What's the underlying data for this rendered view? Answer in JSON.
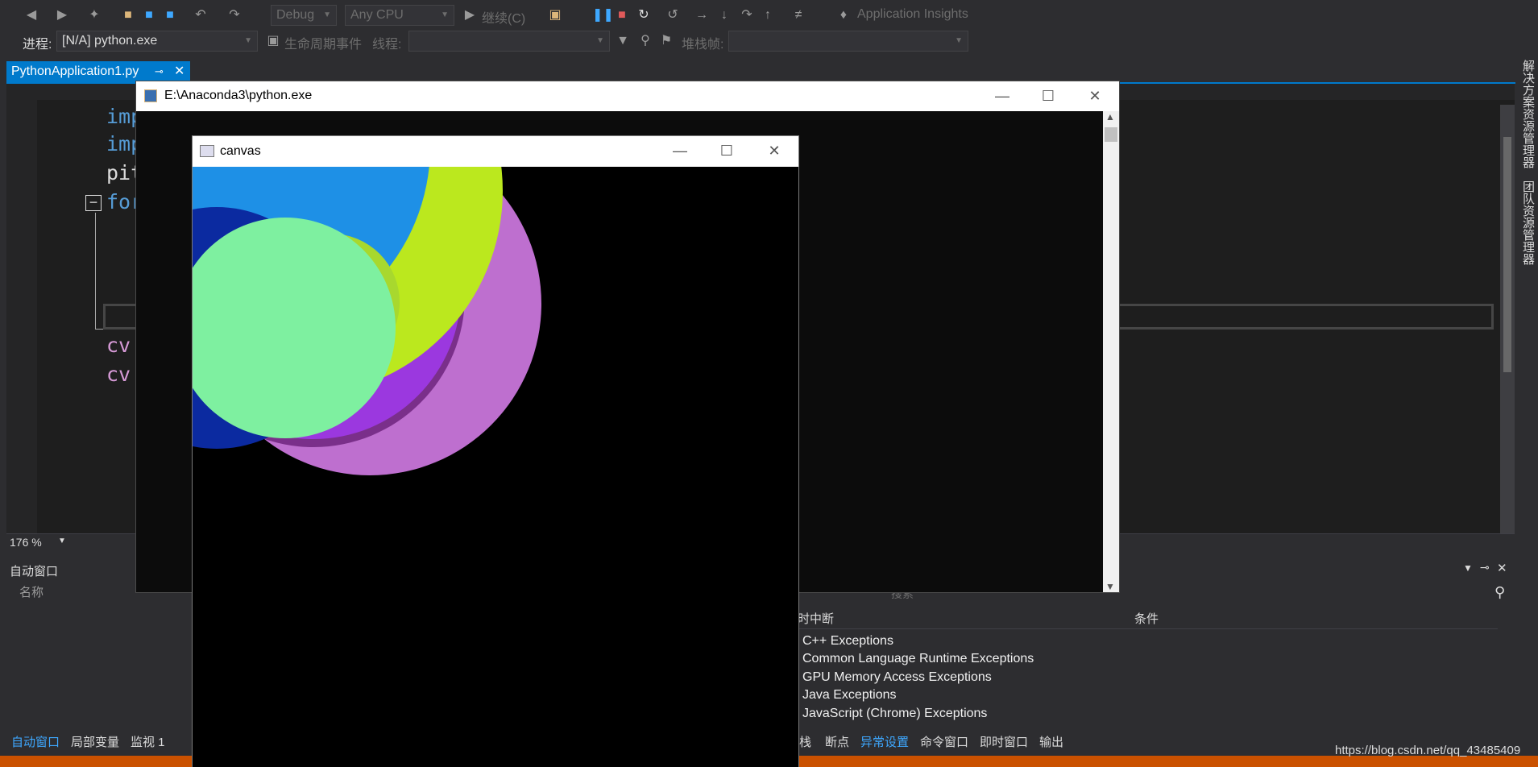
{
  "toolbar": {
    "config": "Debug",
    "platform": "Any CPU",
    "continue_label": "继续(C)",
    "insights": "Application Insights"
  },
  "toolbar2": {
    "process_label": "进程:",
    "process_value": "[N/A] python.exe",
    "lifecycle_label": "生命周期事件",
    "thread_label": "线程:",
    "stack_label": "堆栈帧:"
  },
  "tab": {
    "filename": "PythonApplication1.py"
  },
  "code": {
    "line1": "imp",
    "line2": "imp",
    "line3": "pit",
    "line4": "for",
    "line5": "cv.",
    "line6": "cv."
  },
  "zoom": "176 %",
  "auto_panel": {
    "title": "自动窗口",
    "col_name": "名称"
  },
  "exceptions": {
    "search": "搜索",
    "col_break": "时中断",
    "col_condition": "条件",
    "rows": [
      "C++ Exceptions",
      "Common Language Runtime Exceptions",
      "GPU Memory Access Exceptions",
      "Java Exceptions",
      "JavaScript (Chrome) Exceptions"
    ]
  },
  "bottom_tabs_left": [
    "自动窗口",
    "局部变量",
    "监视 1"
  ],
  "bottom_tabs_right": [
    "栈",
    "断点",
    "异常设置",
    "命令窗口",
    "即时窗口",
    "输出"
  ],
  "right_rail": [
    "解决方案资源管理器",
    "团队资源管理器"
  ],
  "watermark": "https://blog.csdn.net/qq_43485409",
  "console": {
    "title": "E:\\Anaconda3\\python.exe"
  },
  "canvas_window": {
    "title": "canvas"
  },
  "colors": {
    "accent": "#007acc",
    "status_bar": "#ca5100",
    "circle_blue": "#1e90e6",
    "circle_lime": "#bbe81e",
    "circle_violet": "#be6fcf",
    "circle_purple": "#9b38df",
    "circle_yellowgreen": "#a8d82e",
    "circle_mint": "#7ef0a0",
    "circle_navy": "#0b2aa0"
  }
}
